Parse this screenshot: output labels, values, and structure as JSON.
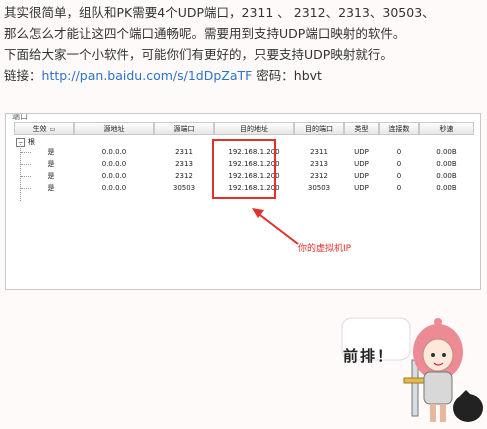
{
  "intro": {
    "line1": "其实很简单，组队和PK需要4个UDP端口，2311 、 2312、2313、30503、",
    "line2": "那么怎么才能让这四个端口通畅呢。需要用到支持UDP端口映射的软件。",
    "line3": "下面给大家一个小软件，可能你们有更好的，只要支持UDP映射就行。",
    "link_label": "链接：",
    "link_url": "http://pan.baidu.com/s/1dDpZaTF",
    "password": " 密码：hbvt"
  },
  "screenshot": {
    "title": "端口",
    "columns": [
      "生效",
      "源地址",
      "源端口",
      "目的地址",
      "目的端口",
      "类型",
      "连接数",
      "秒速"
    ],
    "group_label": "根",
    "group_toggle": "−",
    "rows": [
      {
        "active": "是",
        "src": "0.0.0.0",
        "sport": "2311",
        "dst": "192.168.1.200",
        "dport": "2311",
        "type": "UDP",
        "conn": "0",
        "speed": "0.00B"
      },
      {
        "active": "是",
        "src": "0.0.0.0",
        "sport": "2313",
        "dst": "192.168.1.200",
        "dport": "2313",
        "type": "UDP",
        "conn": "0",
        "speed": "0.00B"
      },
      {
        "active": "是",
        "src": "0.0.0.0",
        "sport": "2312",
        "dst": "192.168.1.200",
        "dport": "2312",
        "type": "UDP",
        "conn": "0",
        "speed": "0.00B"
      },
      {
        "active": "是",
        "src": "0.0.0.0",
        "sport": "30503",
        "dst": "192.168.1.200",
        "dport": "30503",
        "type": "UDP",
        "conn": "0",
        "speed": "0.00B"
      }
    ],
    "annotation": "你的虚拟机IP"
  },
  "sticker": {
    "text": "前排！"
  },
  "colors": {
    "link": "#2a73c9",
    "highlight": "#e2302a",
    "background": "#fffafa"
  }
}
